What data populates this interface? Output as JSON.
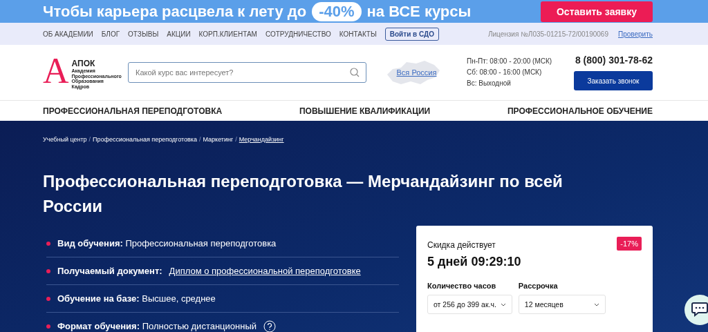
{
  "promo_banner": {
    "text": "Чтобы карьера расцвела к лету до",
    "badge": "-40%",
    "text_after": "на ВСЕ курсы",
    "button": "Оставить заявку"
  },
  "top_nav": {
    "links": [
      "ОБ АКАДЕМИИ",
      "БЛОГ",
      "ОТЗЫВЫ",
      "АКЦИИ",
      "КОРП.КЛИЕНТАМ",
      "СОТРУДНИЧЕСТВО",
      "КОНТАКТЫ"
    ],
    "login_button": "Войти в СДО",
    "license": "Лицензия №Л035-01215-72/00190069",
    "verify_link": "Проверить"
  },
  "header": {
    "logo_letter": "А",
    "logo_title": "АПОК",
    "logo_subtitle": [
      "Академия",
      "Профессионального",
      "Образования",
      "Кадров"
    ],
    "search": {
      "placeholder": "Какой курс вас интересует?"
    },
    "region_link": "Вся Россия",
    "hours": [
      "Пн-Пт: 08:00 - 20:00 (МСК)",
      "Сб: 08:00 - 16:00 (МСК)",
      "Вс: Выходной"
    ],
    "phone": "8 (800) 301-78-62",
    "callback_button": "Заказать звонок"
  },
  "main_nav": [
    "ПРОФЕССИОНАЛЬНАЯ ПЕРЕПОДГОТОВКА",
    "ПОВЫШЕНИЕ КВАЛИФИКАЦИИ",
    "ПРОФЕССИОНАЛЬНОЕ ОБУЧЕНИЕ"
  ],
  "breadcrumb_separator": "/",
  "breadcrumbs": [
    {
      "label": "Учебный центр",
      "current": false
    },
    {
      "label": "Профессиональная переподготовка",
      "current": false
    },
    {
      "label": "Маркетинг",
      "current": false
    },
    {
      "label": "Мерчандайзинг",
      "current": true
    }
  ],
  "title": "Профессиональная переподготовка — Мерчандайзинг по всей России",
  "facts": [
    {
      "label": "Вид обучения:",
      "value": "Профессиональная переподготовка",
      "kind": "text"
    },
    {
      "label": "Получаемый документ:",
      "value": "Диплом о профессиональной переподготовке",
      "kind": "link"
    },
    {
      "label": "Обучение на базе:",
      "value": "Высшее, среднее",
      "kind": "text"
    },
    {
      "label": "Формат обучения:",
      "value": "Полностью дистанционный",
      "kind": "help"
    }
  ],
  "offer_card": {
    "discount_caption": "Скидка действует",
    "countdown": "5 дней 09:29:10",
    "discount_badge": "-17%",
    "selects": [
      {
        "label": "Количество часов",
        "value": "от 256 до 399 ак.ч."
      },
      {
        "label": "Рассрочка",
        "value": "12 месяцев"
      }
    ]
  }
}
